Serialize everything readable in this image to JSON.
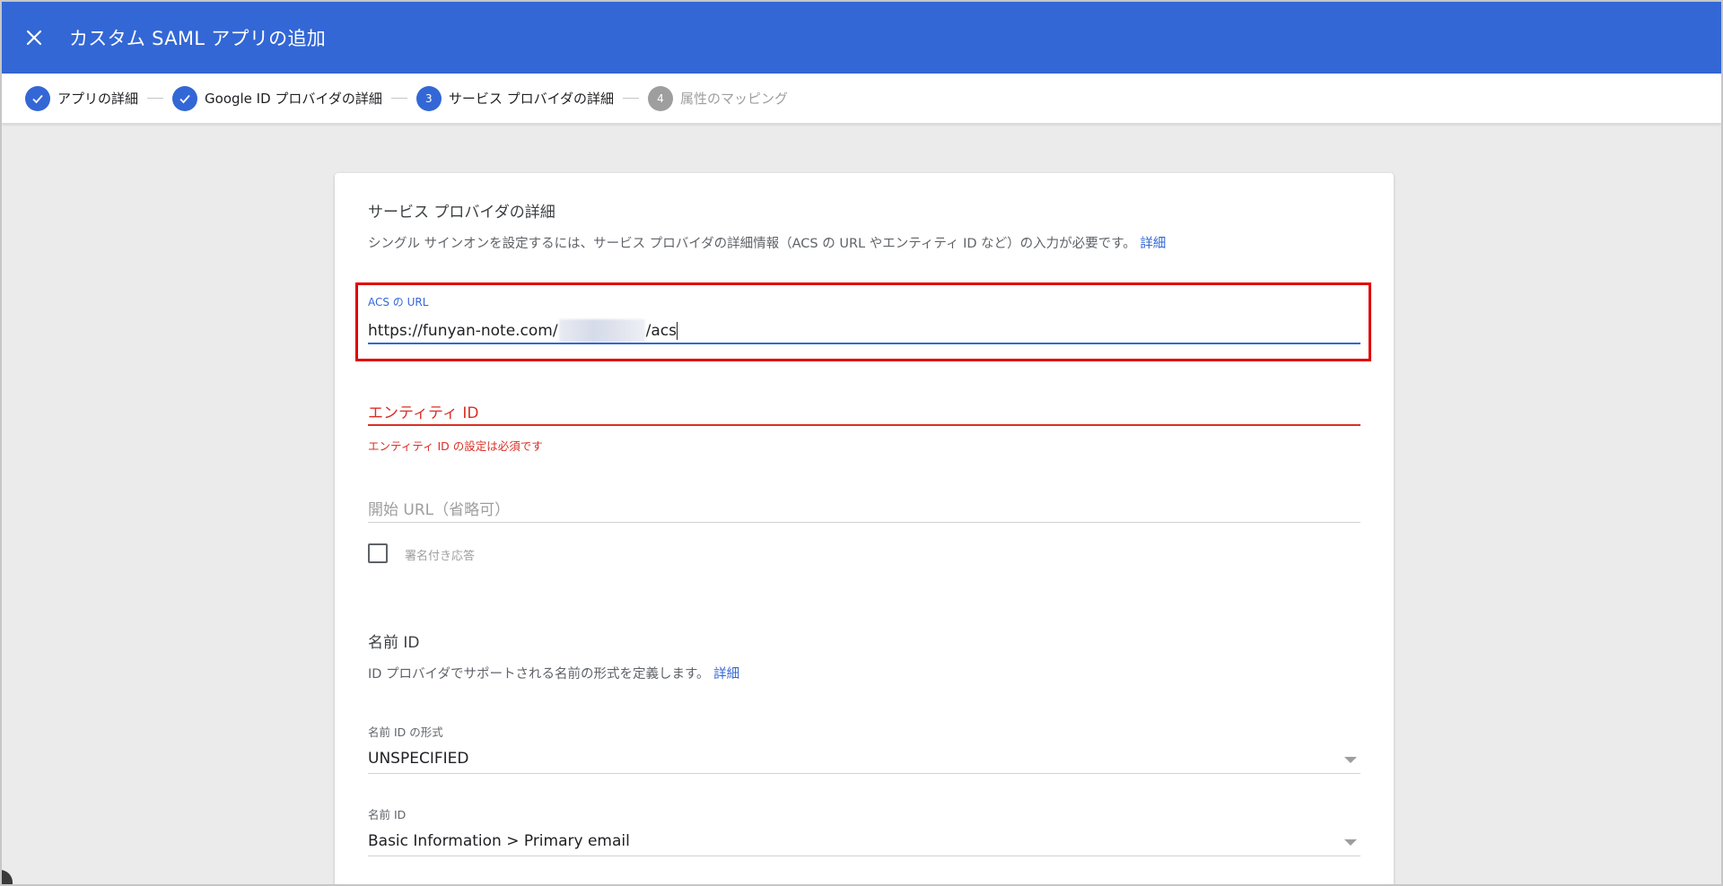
{
  "header": {
    "title": "カスタム SAML アプリの追加",
    "color": "#3367d6"
  },
  "stepper": {
    "steps": [
      {
        "label": "アプリの詳細",
        "state": "done",
        "number": ""
      },
      {
        "label": "Google ID プロバイダの詳細",
        "state": "done",
        "number": ""
      },
      {
        "label": "サービス プロバイダの詳細",
        "state": "current",
        "number": "3"
      },
      {
        "label": "属性のマッピング",
        "state": "inactive",
        "number": "4"
      }
    ]
  },
  "sp_details": {
    "title": "サービス プロバイダの詳細",
    "description": "シングル サインオンを設定するには、サービス プロバイダの詳細情報（ACS の URL やエンティティ ID など）の入力が必要です。",
    "details_link": "詳細",
    "acs_url": {
      "label": "ACS の URL",
      "value_prefix": "https://funyan-note.com/",
      "value_suffix": "/acs"
    },
    "entity_id": {
      "placeholder": "エンティティ ID",
      "error": "エンティティ ID の設定は必須です"
    },
    "start_url": {
      "placeholder": "開始 URL（省略可）"
    },
    "signed_response": {
      "label": "署名付き応答",
      "checked": false
    }
  },
  "name_id": {
    "title": "名前 ID",
    "description": "ID プロバイダでサポートされる名前の形式を定義します。",
    "details_link": "詳細",
    "format": {
      "label": "名前 ID の形式",
      "value": "UNSPECIFIED"
    },
    "name_id_field": {
      "label": "名前 ID",
      "value": "Basic Information > Primary email"
    }
  },
  "colors": {
    "accent": "#3367d6",
    "error": "#d93025",
    "highlight_box": "#e00000"
  }
}
